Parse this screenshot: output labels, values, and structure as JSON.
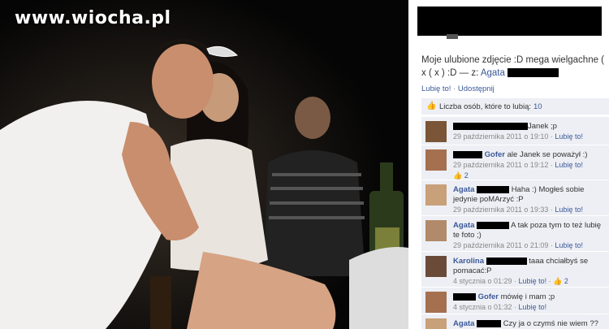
{
  "watermark": "www.wiocha.pl",
  "post": {
    "caption_text": "Moje ulubione zdjęcie :D mega wielgachne ( x ( x ) :D — z:",
    "tagged_name": "Agata",
    "like_label": "Lubię to!",
    "share_label": "Udostępnij",
    "likes_label": "Liczba osób, które to lubią:",
    "likes_count": "10"
  },
  "comments": [
    {
      "name": "",
      "text": "Janek ;p",
      "meta": "29 października 2011 o 19:10 · ",
      "like": "Lubię to!",
      "count": ""
    },
    {
      "name": "Gofer",
      "text": "ale Janek se poważył :)",
      "meta": "29 października 2011 o 19:12 · ",
      "like": "Lubię to!",
      "count": "2"
    },
    {
      "name": "Agata",
      "text": "Haha :) Mogłeś sobie jedynie poMArzyć :P",
      "meta": "29 października 2011 o 19:33 · ",
      "like": "Lubię to!",
      "count": ""
    },
    {
      "name": "Agata",
      "text": "A tak poza tym to też lubię te foto ;)",
      "meta": "29 października 2011 o 21:09 · ",
      "like": "Lubię to!",
      "count": ""
    },
    {
      "name": "Karolina",
      "text": "taaa chciałbyś se pomacać:P",
      "meta": "4 stycznia o 01:29 · ",
      "like": "Lubię to!",
      "count": "2"
    },
    {
      "name": "Gofer",
      "text": "mówię i mam ;p",
      "meta": "4 stycznia o 01:32 · ",
      "like": "Lubię to!",
      "count": ""
    },
    {
      "name": "Agata",
      "text": "Czy ja o czymś nie wiem ??",
      "meta": "",
      "like": "",
      "count": ""
    }
  ],
  "colors": {
    "link": "#3b5998",
    "panel_bg": "#edeff4"
  }
}
